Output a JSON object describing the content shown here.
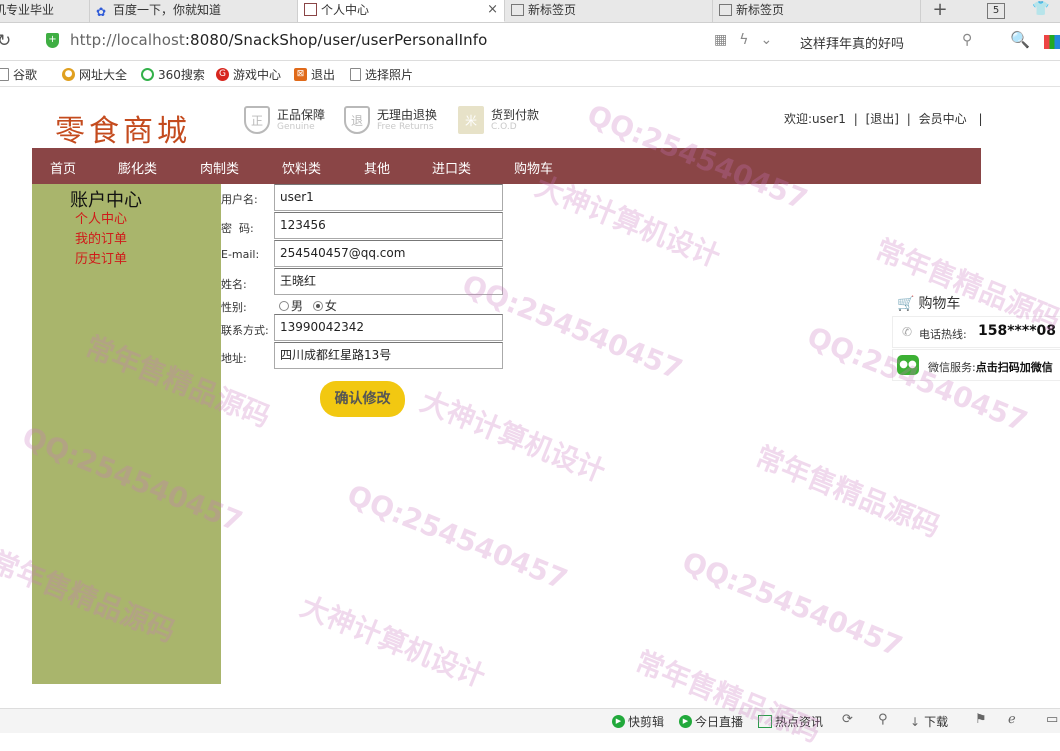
{
  "browser": {
    "tabs": [
      {
        "label": "机专业毕业",
        "active": false
      },
      {
        "label": "百度一下，你就知道",
        "active": false
      },
      {
        "label": "个人中心",
        "active": true
      },
      {
        "label": "新标签页",
        "active": false
      },
      {
        "label": "新标签页",
        "active": false
      }
    ],
    "tab_close": "×",
    "new_tab": "+",
    "tab_count": "5",
    "url_host": "http://localhost",
    "url_rest": ":8080/SnackShop/user/userPersonalInfo",
    "search_text": "这样拜年真的好吗",
    "bookmarks": [
      "谷歌",
      "网址大全",
      "360搜索",
      "游戏中心",
      "退出",
      "选择照片"
    ]
  },
  "header": {
    "logo": "零食商城",
    "badges": [
      {
        "icon": "正",
        "title": "正品保障",
        "sub": "Genuine"
      },
      {
        "icon": "退",
        "title": "无理由退换",
        "sub": "Free Returns"
      },
      {
        "icon": "米",
        "title": "货到付款",
        "sub": "C.O.D"
      }
    ],
    "welcome": "欢迎:user1",
    "logout": "[退出]",
    "member": "会员中心",
    "sep": "|"
  },
  "nav": [
    "首页",
    "膨化类",
    "肉制类",
    "饮料类",
    "其他",
    "进口类",
    "购物车"
  ],
  "sidebar": {
    "title": "账户中心",
    "links": [
      "个人中心",
      "我的订单",
      "历史订单"
    ]
  },
  "form": {
    "username": {
      "label": "用户名:",
      "value": "user1"
    },
    "password": {
      "label": "密  码:",
      "value": "123456"
    },
    "email": {
      "label": "E-mail:",
      "value": "254540457@qq.com"
    },
    "name": {
      "label": "姓名:",
      "value": "王晓红"
    },
    "gender": {
      "label": "性别:",
      "options": [
        "男",
        "女"
      ],
      "selected": "女"
    },
    "phone": {
      "label": "联系方式:",
      "value": "13990042342"
    },
    "address": {
      "label": "地址:",
      "value": "四川成都红星路13号"
    },
    "submit": "确认修改"
  },
  "float_panel": {
    "cart": "购物车",
    "hotline_label": "电话热线:",
    "hotline_value": "158****08",
    "wechat_label": "微信服务:",
    "wechat_value": "点击扫码加微信"
  },
  "statusbar": [
    "快剪辑",
    "今日直播",
    "热点资讯",
    "下载"
  ],
  "watermarks": [
    "QQ:254540457",
    "常年售精品源码",
    "大神计算机设计"
  ],
  "colors": {
    "nav_bg": "#8a4546",
    "sidebar_bg": "#a9b56c",
    "submit_bg": "#f2c811",
    "link_red": "#d01a1a",
    "logo": "#c44b1e"
  }
}
